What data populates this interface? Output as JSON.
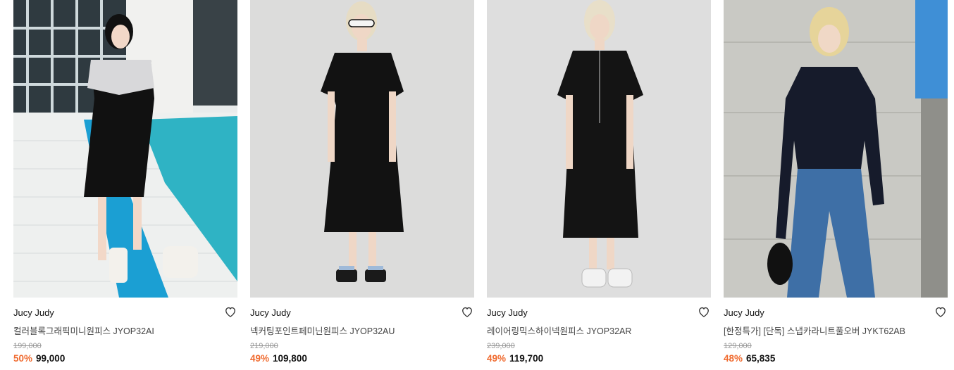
{
  "products": [
    {
      "brand": "Jucy Judy",
      "name": "컬러블록그래픽미니원피스 JYOP32AI",
      "original_price": "199,000",
      "discount": "50%",
      "price": "99,000",
      "image_alt": "pool-side",
      "heart_icon": "heart-outline-icon"
    },
    {
      "brand": "Jucy Judy",
      "name": "넥커팅포인트페미닌원피스 JYOP32AU",
      "original_price": "219,000",
      "discount": "49%",
      "price": "109,800",
      "heart_icon": "heart-outline-icon"
    },
    {
      "brand": "Jucy Judy",
      "name": "레이어링믹스하이넥원피스 JYOP32AR",
      "original_price": "239,000",
      "discount": "49%",
      "price": "119,700",
      "heart_icon": "heart-outline-icon"
    },
    {
      "brand": "Jucy Judy",
      "name": "[한정특가] [단독] 스냅카라니트풀오버 JYKT62AB",
      "original_price": "129,000",
      "discount": "48%",
      "price": "65,835",
      "heart_icon": "heart-outline-icon"
    }
  ],
  "colors": {
    "discount": "#f06a2e",
    "price": "#111111",
    "original_price": "#999999"
  }
}
